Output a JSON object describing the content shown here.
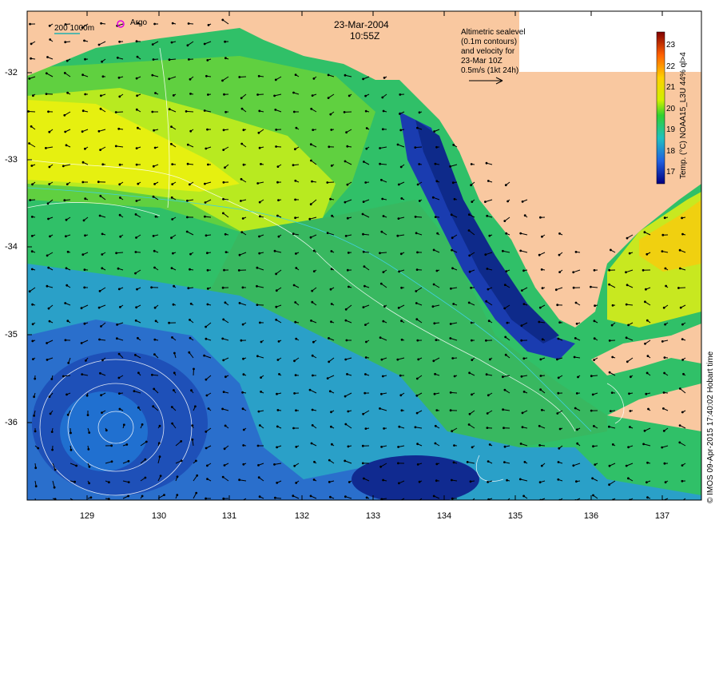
{
  "title": {
    "date": "23-Mar-2004",
    "time": "10:55Z"
  },
  "legend_text": "Altimetric sealevel\n(0.1m contours)\nand velocity for\n23-Mar 10Z\n0.5m/s (1kt 24h)",
  "scale_label": "200  1000m",
  "argo_label": "Argo",
  "colorbar": {
    "title": "Temp. (°C) NOAA15_L3U 44% ql>4",
    "ticks": [
      "23",
      "22",
      "21",
      "20",
      "19",
      "18",
      "17"
    ]
  },
  "axes": {
    "y_ticks": [
      "-32",
      "-33",
      "-34",
      "-35",
      "-36"
    ],
    "x_ticks": [
      "129",
      "130",
      "131",
      "132",
      "133",
      "134",
      "135",
      "136",
      "137"
    ]
  },
  "credit": "© IMOS 09-Apr-2015 17:40:02 Hobart time",
  "colors": {
    "land": "#f9c8a0",
    "warm": "#e0f000",
    "mid": "#22cc33",
    "cool": "#22aadd",
    "cold": "#1030a0",
    "contour": "#ffffff"
  }
}
